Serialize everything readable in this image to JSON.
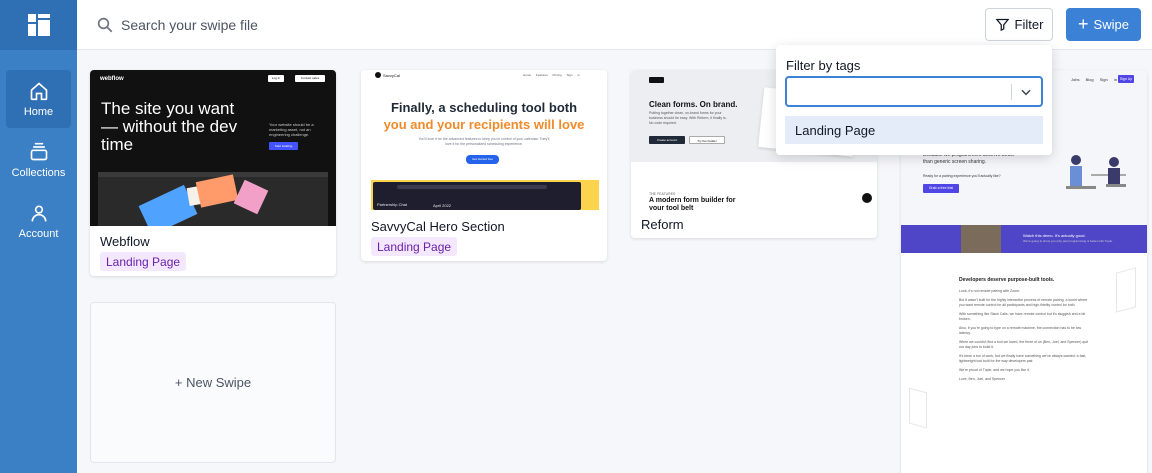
{
  "sidebar": {
    "logo_icon": "grid-logo-icon",
    "items": [
      {
        "label": "Home",
        "icon": "home-icon",
        "active": true
      },
      {
        "label": "Collections",
        "icon": "collections-icon",
        "active": false
      },
      {
        "label": "Account",
        "icon": "account-icon",
        "active": false
      }
    ]
  },
  "header": {
    "search_placeholder": "Search your swipe file",
    "filter_label": "Filter",
    "swipe_label": "Swipe"
  },
  "cards": [
    {
      "title": "Webflow",
      "tag": "Landing Page",
      "preview": {
        "brand": "webflow",
        "headline": "The site you want — without the dev time",
        "side_text": "Your website should be a marketing asset, not an engineering challenge.",
        "cta": "Start building",
        "nav_login": "Log in",
        "nav_contact": "Contact sales",
        "nav_start": "Get started — it's free"
      }
    },
    {
      "title": "SavvyCal Hero Section",
      "tag": "Landing Page",
      "preview": {
        "brand": "SavvyCal",
        "headline_1": "Finally, a scheduling tool both",
        "headline_2": "you and your recipients will love",
        "sub": "You'll love it for the advanced features to keep you in control of your calendar. They'll love it for the personalized scheduling experience.",
        "cta": "Get started free",
        "nav": [
          "Home",
          "Features",
          "Pricing",
          "Sign in"
        ],
        "app_name": "Partnership Chat",
        "app_date": "April 2022"
      }
    },
    {
      "title": "Reform",
      "tag": "",
      "preview": {
        "brand": "Reform",
        "headline": "Clean forms. On brand.",
        "sub": "Putting together clean, on-brand forms for your business should be easy. With Reform, it finally is. No code required.",
        "cta1": "Create account",
        "cta2": "Try live builder",
        "features_label": "THE FEATURES",
        "features_headline": "A modern form builder for your tool belt"
      }
    }
  ],
  "tall_preview": {
    "nav": [
      "Jobs",
      "Blog",
      "Sign in",
      "Sign Up"
    ],
    "hero_text": "Because we programmers deserve better than generic screen sharing.",
    "hero_sub": "Ready for a pairing experience you'll actually like?",
    "hero_cta": "Grab a free trial",
    "video_title": "Watch this demo. It's actually good.",
    "video_sub": "We're going to show you why pair programming is better with Tuple.",
    "body_title": "Developers deserve purpose-built tools.",
    "body_lines": [
      "Look, it's not remote pairing with Zoom.",
      "But it wasn't built for the highly interactive process of remote pairing, a world where you want remote control for all participants and high-fidelity control for both.",
      "With something like Slack Calls, we have remote control but it's sluggish and a bit broken.",
      "Also, if you're going to type on a remote machine, the connection has to be low latency.",
      "When we couldn't find a tool we loved, the three of us (Ben, Joel, and Spencer) quit our day jobs to build it.",
      "It's been a ton of work, but we finally have something we've always wanted: a fast, lightweight tool built for the way developers pair.",
      "We're proud of Tuple, and we hope you like it.",
      "Love, Ben, Joel, and Spencer"
    ]
  },
  "new_swipe_label": "+ New Swipe",
  "filter_popover": {
    "title": "Filter by tags",
    "select_value": "",
    "options": [
      "Landing Page"
    ]
  },
  "colors": {
    "sidebar": "#3b7fc4",
    "sidebar_active": "#2f6fb3",
    "accent": "#3b82d6",
    "tag_bg": "#f3e8ff",
    "tag_text": "#6b21a8",
    "option_highlight": "#e5ecf9"
  }
}
